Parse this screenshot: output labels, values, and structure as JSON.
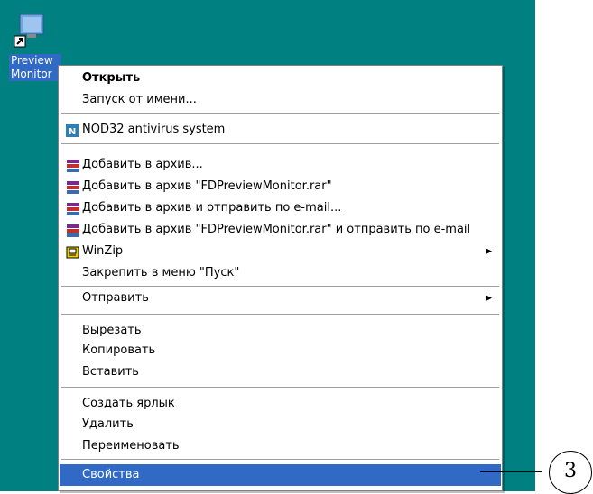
{
  "desktop": {
    "shortcut_label_line1": "Preview",
    "shortcut_label_line2": "Monitor"
  },
  "menu": {
    "open": "Открыть",
    "run_as": "Запуск от имени...",
    "nod32": "NOD32 antivirus system",
    "add_archive": "Добавить в архив...",
    "add_archive_named": "Добавить в архив \"FDPreviewMonitor.rar\"",
    "add_archive_email": "Добавить в архив и отправить по e-mail...",
    "add_archive_named_email": "Добавить в архив \"FDPreviewMonitor.rar\" и отправить по e-mail",
    "winzip": "WinZip",
    "pin_start": "Закрепить в меню \"Пуск\"",
    "send_to": "Отправить",
    "cut": "Вырезать",
    "copy": "Копировать",
    "paste": "Вставить",
    "create_shortcut": "Создать ярлык",
    "delete": "Удалить",
    "rename": "Переименовать",
    "properties": "Свойства"
  },
  "callout": {
    "number": "3"
  },
  "icons": {
    "winrar": "winrar-icon",
    "nod32": "nod32-icon",
    "winzip": "winzip-icon",
    "shortcut": "monitor-shortcut-icon"
  },
  "colors": {
    "desktop": "#008080",
    "highlight": "#316ac5"
  }
}
